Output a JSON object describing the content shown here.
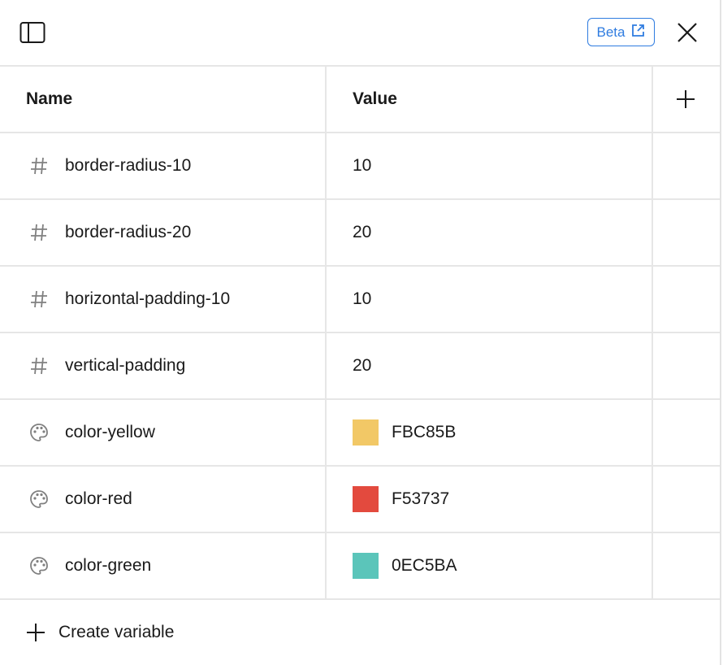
{
  "header": {
    "beta_label": "Beta"
  },
  "table": {
    "columns": {
      "name": "Name",
      "value": "Value"
    },
    "rows": [
      {
        "type": "number",
        "icon": "hash-icon",
        "name": "border-radius-10",
        "value": "10"
      },
      {
        "type": "number",
        "icon": "hash-icon",
        "name": "border-radius-20",
        "value": "20"
      },
      {
        "type": "number",
        "icon": "hash-icon",
        "name": "horizontal-padding-10",
        "value": "10"
      },
      {
        "type": "number",
        "icon": "hash-icon",
        "name": "vertical-padding",
        "value": "20"
      },
      {
        "type": "color",
        "icon": "palette-icon",
        "name": "color-yellow",
        "value": "FBC85B",
        "color": "#F2C866"
      },
      {
        "type": "color",
        "icon": "palette-icon",
        "name": "color-red",
        "value": "F53737",
        "color": "#E34A3E"
      },
      {
        "type": "color",
        "icon": "palette-icon",
        "name": "color-green",
        "value": "0EC5BA",
        "color": "#5BC5BA"
      }
    ]
  },
  "footer": {
    "create_label": "Create variable"
  },
  "colors": {
    "accent": "#2f7ce0",
    "border": "#e6e6e6"
  }
}
